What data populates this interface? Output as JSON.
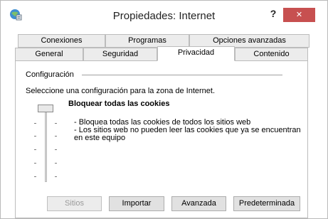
{
  "window": {
    "title": "Propiedades: Internet",
    "help_label": "?",
    "close_label": "✕"
  },
  "tabs": {
    "row1": [
      {
        "label": "Conexiones"
      },
      {
        "label": "Programas"
      },
      {
        "label": "Opciones avanzadas"
      }
    ],
    "row2": [
      {
        "label": "General"
      },
      {
        "label": "Seguridad"
      },
      {
        "label": "Privacidad",
        "active": true
      },
      {
        "label": "Contenido"
      }
    ]
  },
  "privacy": {
    "group_label": "Configuración",
    "intro": "Seleccione una configuración para la zona de Internet.",
    "slider_level": "top",
    "level_title": "Bloquear todas las cookies",
    "level_desc": [
      "- Bloquea todas las cookies de todos los sitios web",
      "- Los sitios web no pueden leer las cookies que ya se encuentran",
      "en este equipo"
    ]
  },
  "buttons": {
    "sites": "Sitios",
    "import": "Importar",
    "advanced": "Avanzada",
    "default": "Predeterminada"
  },
  "colors": {
    "close_button": "#c75050",
    "tab_inactive": "#ececec",
    "border": "#bcbcbc"
  }
}
